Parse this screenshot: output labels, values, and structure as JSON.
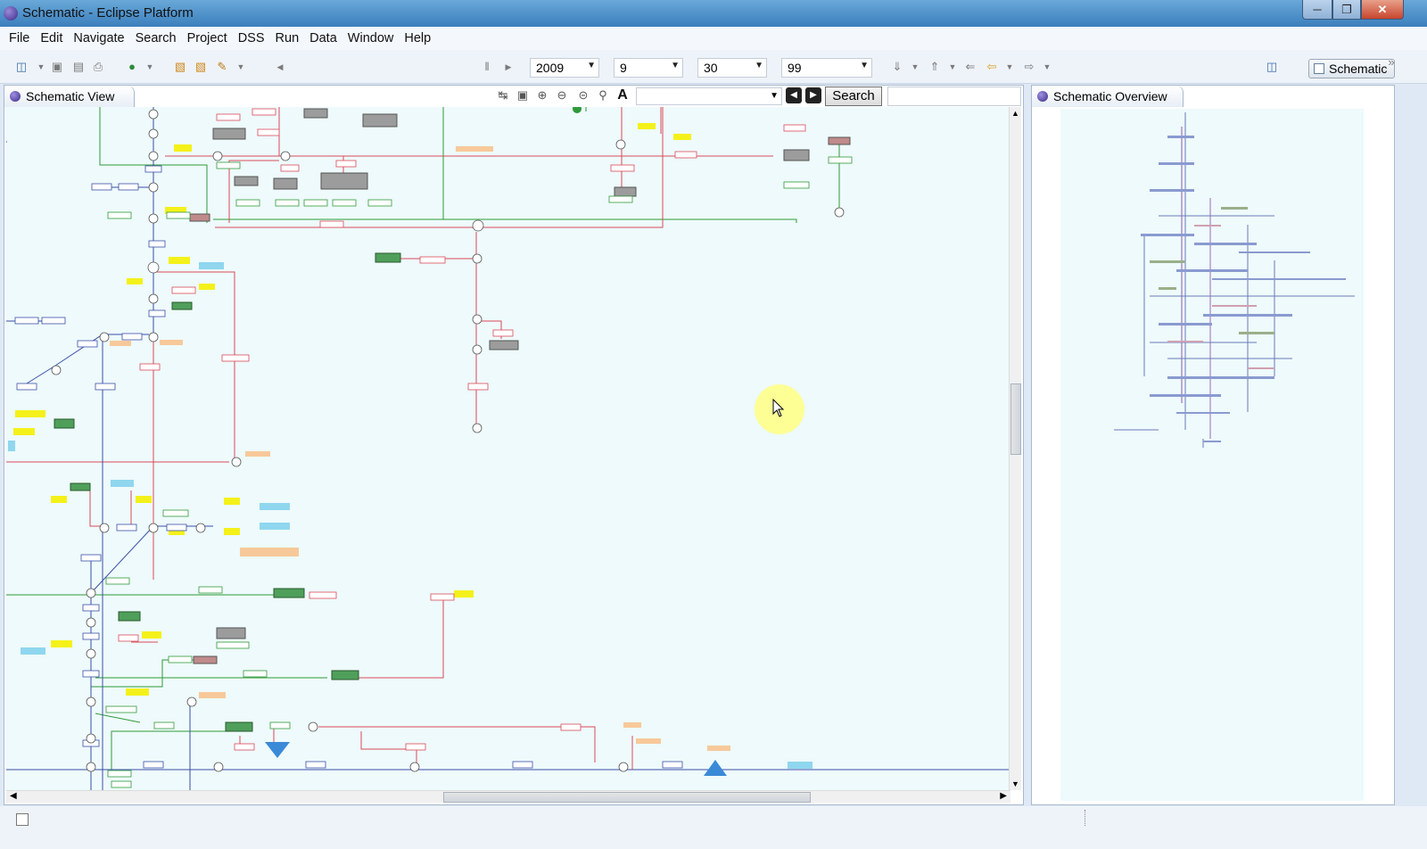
{
  "window": {
    "title": "Schematic - Eclipse Platform"
  },
  "menu": [
    "File",
    "Edit",
    "Navigate",
    "Search",
    "Project",
    "DSS",
    "Run",
    "Data",
    "Window",
    "Help"
  ],
  "toolbar": {
    "year": "2009",
    "month": "9",
    "day": "30",
    "level": "99",
    "perspective_label": "Schematic"
  },
  "schematic_view": {
    "tab_label": "Schematic View",
    "search_label": "Search",
    "search_value": "",
    "filter_value": ""
  },
  "overview_view": {
    "tab_label": "Schematic Overview"
  },
  "colors": {
    "canvas_bg": "#eefafb",
    "link_red": "#d94a5a",
    "link_green": "#2f9a3a",
    "link_blue": "#3a4fa8",
    "node_yellow": "#f4f11a",
    "node_green": "#4f9f5a",
    "node_gray": "#9c9c9c",
    "node_cyan": "#8fd6ef",
    "node_orange": "#f7c99a"
  }
}
